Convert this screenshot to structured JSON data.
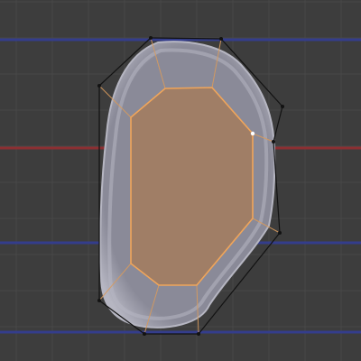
{
  "viewport": {
    "mode": "edit-mode",
    "view": "top-orthographic"
  },
  "colors": {
    "background": "#3d3d3d",
    "grid_minor": "#484848",
    "grid_major_blue": "#343d8c",
    "grid_major_red": "#8c2f32",
    "mesh_shaded": "#8a8a98",
    "mesh_highlight": "#b6b6c2",
    "face_selected": "#a07e66",
    "edge_selected": "#f0a55a",
    "edge_unselected": "#d89a5c",
    "cage_wire": "#121212",
    "vertex_active": "#ffffff"
  },
  "object": {
    "name_visible": false,
    "cage_vertices": 12,
    "inner_face_vertices": 8,
    "selection": "inner-face",
    "active_vertex_index": 6
  }
}
